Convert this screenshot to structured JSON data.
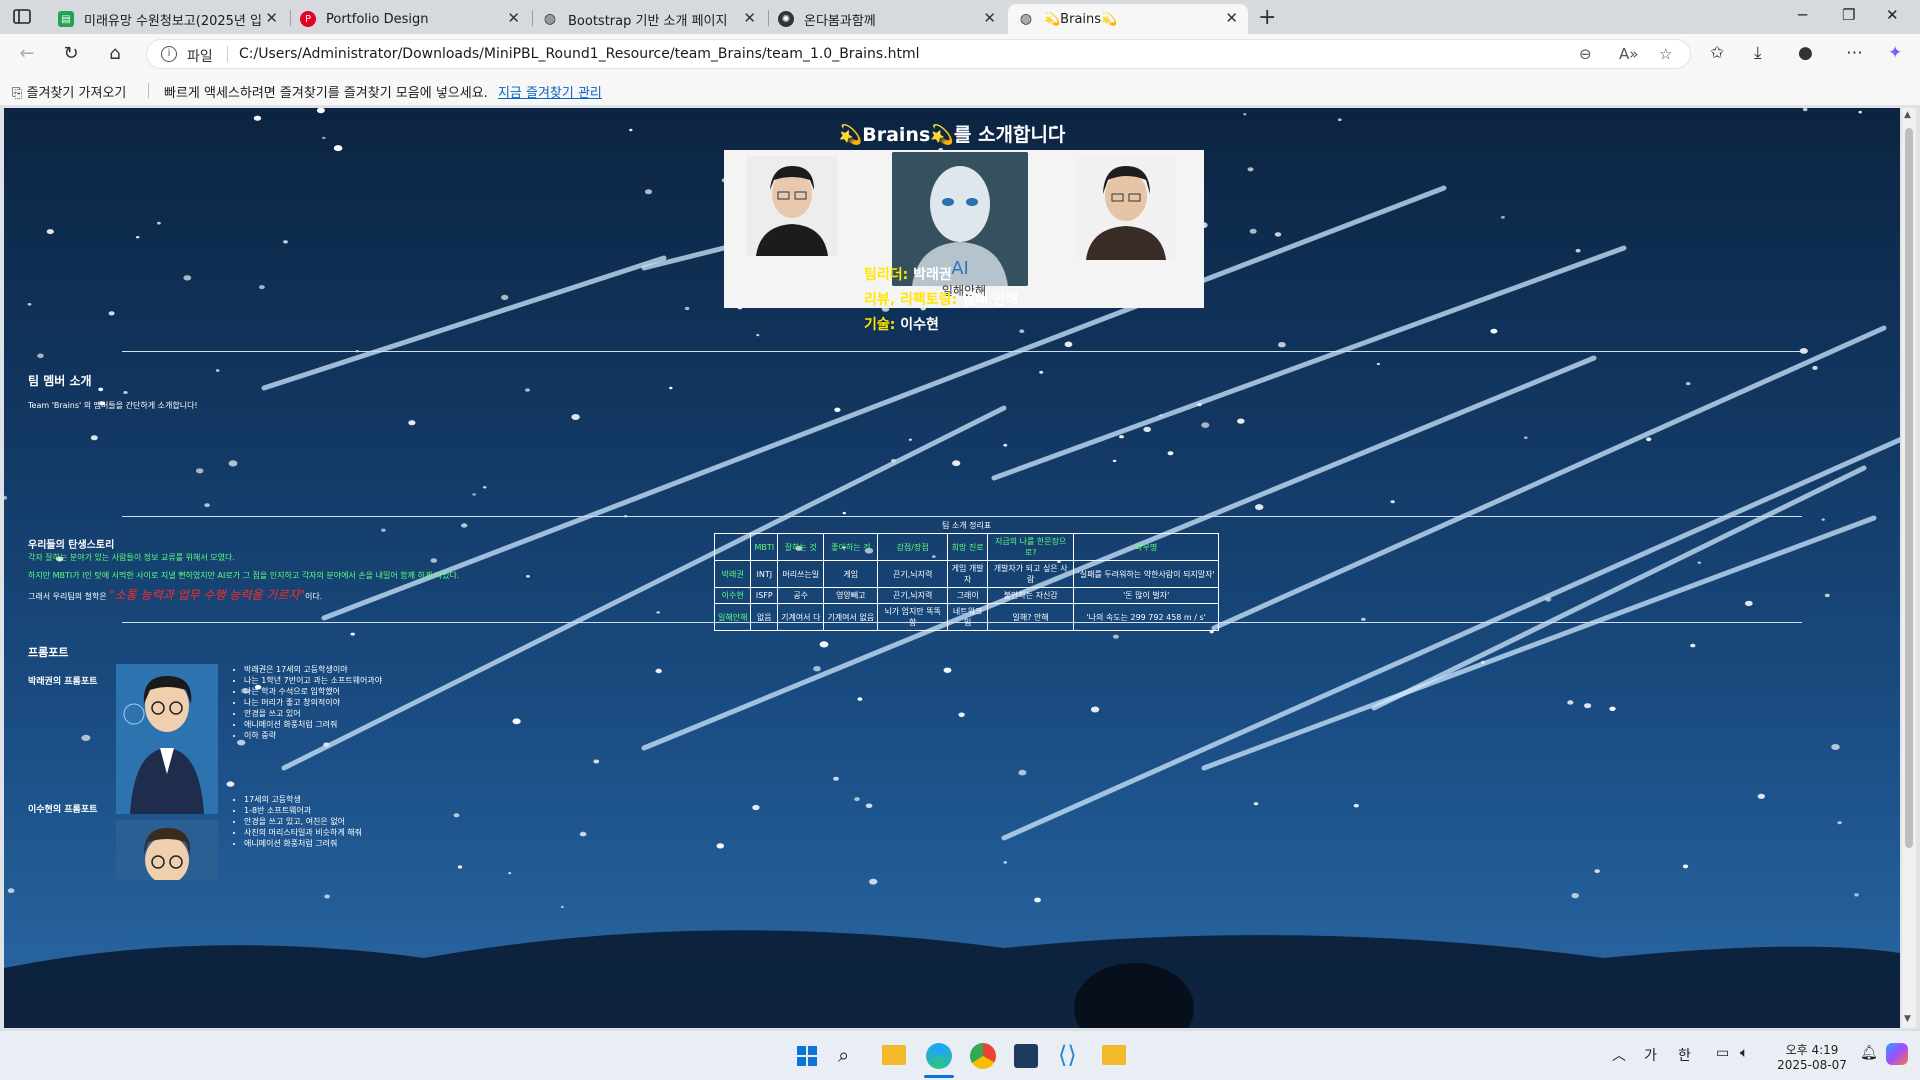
{
  "browser": {
    "tabs": [
      {
        "title": "미래유망 수원청보고(2025년 입",
        "icon": "green-doc-icon",
        "active": false
      },
      {
        "title": "Portfolio Design",
        "icon": "pinterest-icon",
        "active": false
      },
      {
        "title": "Bootstrap 기반 소개 페이지",
        "icon": "globe-icon",
        "active": false
      },
      {
        "title": "온다봄과함께",
        "icon": "chatgpt-icon",
        "active": false
      },
      {
        "title": "💫Brains💫",
        "icon": "globe-icon",
        "active": true
      }
    ],
    "address": {
      "scheme_label": "파일",
      "url": "C:/Users/Administrator/Downloads/MiniPBL_Round1_Resource/team_Brains/team_1.0_Brains.html"
    },
    "favorites_bar": {
      "import_label": "즐겨찾기 가져오기",
      "message": "빠르게 액세스하려면 즐겨찾기를 즐겨찾기 모음에 넣으세요.",
      "manage_link": "지금 즐겨찾기 관리"
    }
  },
  "page": {
    "title": "💫Brains💫를 소개합니다",
    "photo_caption": "일해안해",
    "roles": [
      {
        "label": "팀리더:",
        "value": "박래권"
      },
      {
        "label": "리뷰, 리팩토링:",
        "value": "일해 안해"
      },
      {
        "label": "기술:",
        "value": "이수현"
      }
    ],
    "members_section": {
      "heading": "팀 멤버 소개",
      "desc": "Team 'Brains' 의 멤버들을 간단하게 소개합니다!"
    },
    "table": {
      "caption": "팀 소개 정리표",
      "headers": [
        "",
        "MBTI",
        "잘하는 것",
        "좋아하는 것",
        "강점/장점",
        "희망 진로",
        "지금의 나를 한문장으로?",
        "좌우명"
      ],
      "rows": [
        [
          "박래권",
          "INTJ",
          "머리쓰는일",
          "게임",
          "끈기,뇌지력",
          "게임 개발자",
          "개발자가 되고 싶은 사람",
          "'실패를 두려워하는 약한사람이 되지말자'"
        ],
        [
          "이수현",
          "ISFP",
          "공수",
          "영양빼고",
          "끈기,뇌지력",
          "그래이",
          "불안하는 자신감",
          "'돈 많이 벌자'"
        ],
        [
          "일해안해",
          "없음",
          "기계여서 다",
          "기계여서 없음",
          "뇌가 엄지만 똑똑함",
          "네트워크임",
          "일해? 안해",
          "'나의 속도는 299 792 458 m / s'"
        ]
      ]
    },
    "story": {
      "heading": "우리들의 탄생스토리",
      "line1": "각자 잘하는 분야가 있는 사람들이 정보 교류를 위해서 모였다.",
      "line2": "하지만 MBTI가 I인 탓에 서먹한 사이로 지낼 뻔하였지만 AI로가 그 점을 인지하고 각자의 분야에서 손을 내밀어 함께 하게 되었다.",
      "motto_prefix": "그래서 우리팀의 철학은 ",
      "motto": "\"소통 능력과 업무 수행 능력을 기르자\"",
      "motto_suffix": "이다."
    },
    "portfolio": {
      "heading": "프롬포트",
      "items": [
        {
          "label": "박래권의 프롬포트",
          "lines": [
            "박래권은 17세의 고등학생이야",
            "나는 1학년 7반이고 과는 소프트웨어과야",
            "나는 학과 수석으로 입학했어",
            "나는 머리가 좋고 창의적이야",
            "안경을 쓰고 있어",
            "애니메이션 화풍처럼 그려줘",
            "이하 중략"
          ]
        },
        {
          "label": "이수현의 프롬포트",
          "lines": [
            "17세의 고등학생",
            "1-8반 소프트웨어과",
            "안경을 쓰고 있고, 여친은 없어",
            "사진의 머리스타일과 비슷하게 해줘",
            "애니메이션 화풍처럼 그려줘"
          ]
        }
      ]
    }
  },
  "taskbar": {
    "time": "오후 4:19",
    "date": "2025-08-07",
    "ime_1": "가",
    "ime_2": "한"
  },
  "colors": {
    "accent_yellow": "#ffe600",
    "accent_green": "#5dff7a",
    "motto_red": "#ff2a2a"
  }
}
